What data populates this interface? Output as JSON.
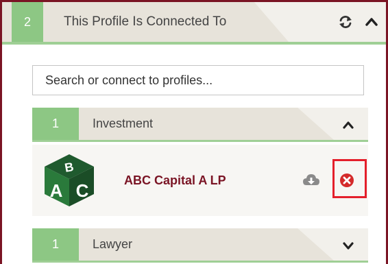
{
  "connected_panel": {
    "count": "2",
    "title": "This Profile Is Connected To",
    "refresh_icon": "refresh-icon",
    "collapse_icon": "chevron-up-icon"
  },
  "search": {
    "placeholder": "Search or connect to profiles..."
  },
  "groups": [
    {
      "count": "1",
      "title": "Investment",
      "toggle_icon": "chevron-up-icon",
      "expanded": true,
      "items": [
        {
          "name": "ABC Capital A LP",
          "logo": "abc-blocks-logo",
          "download_icon": "cloud-download-icon",
          "remove_icon": "remove-icon"
        }
      ]
    },
    {
      "count": "1",
      "title": "Lawyer",
      "toggle_icon": "chevron-down-icon",
      "expanded": false
    }
  ],
  "colors": {
    "accent_green": "#8dc784",
    "brand_red": "#7a1424",
    "highlight_red": "#e41f2b",
    "remove_red": "#d42a2a"
  }
}
